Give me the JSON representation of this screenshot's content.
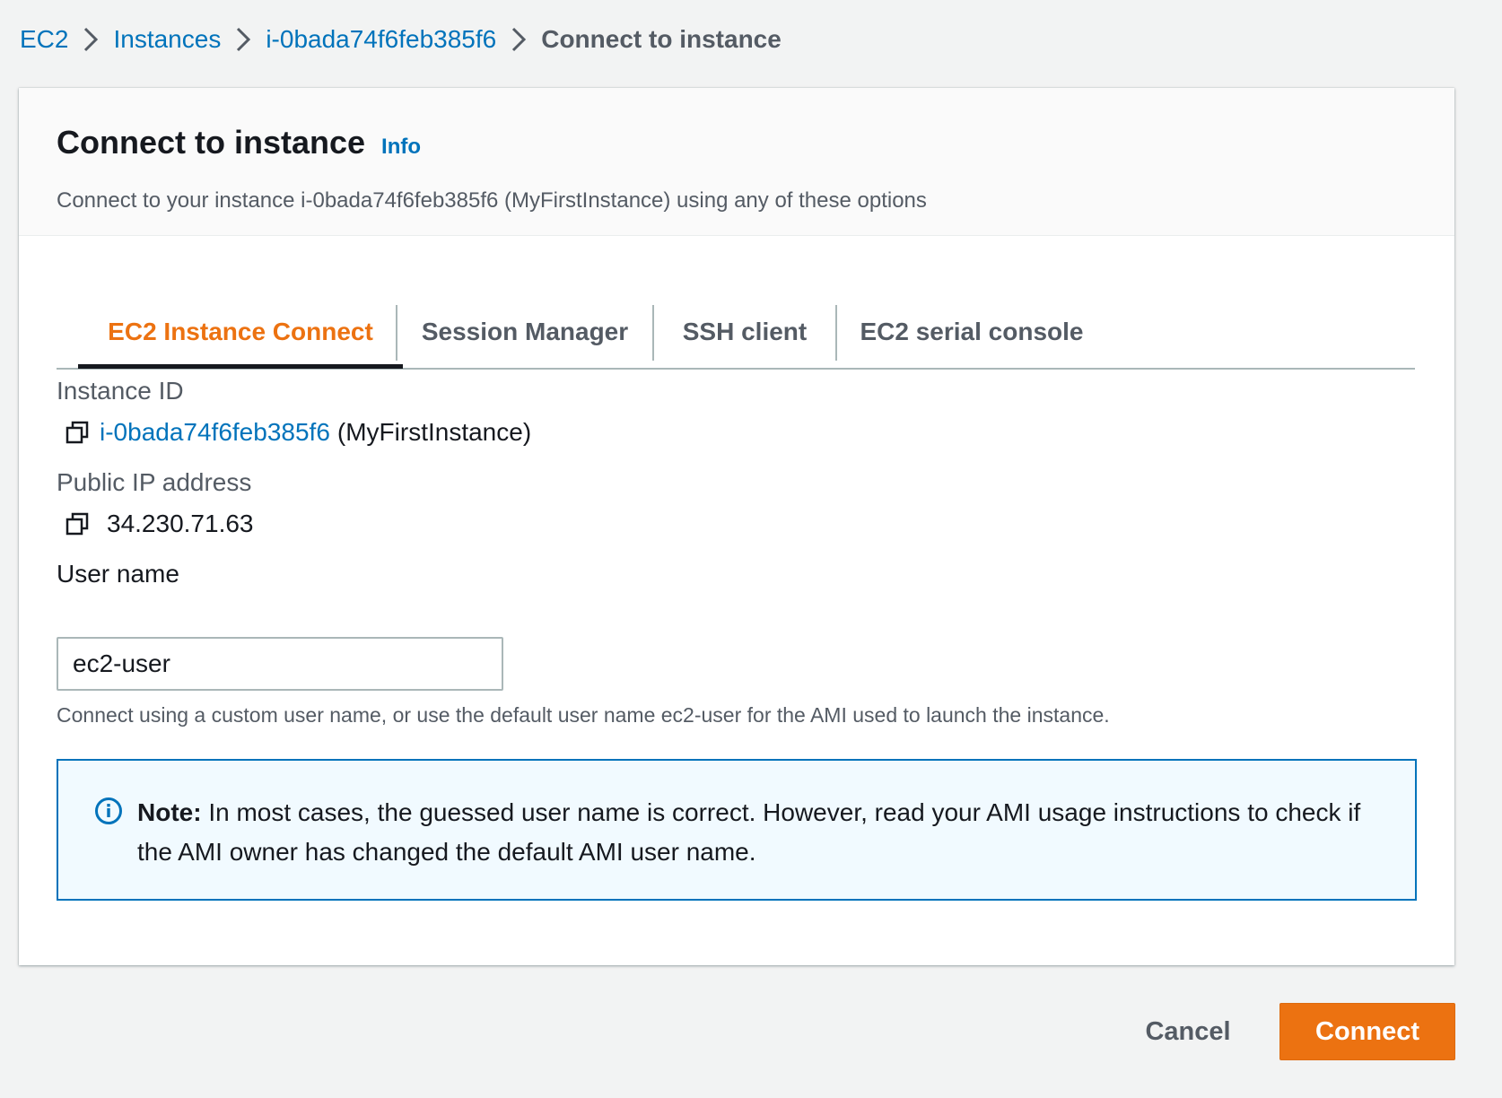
{
  "breadcrumb": {
    "items": [
      {
        "label": "EC2"
      },
      {
        "label": "Instances"
      },
      {
        "label": "i-0bada74f6feb385f6"
      },
      {
        "label": "Connect to instance"
      }
    ]
  },
  "header": {
    "title": "Connect to instance",
    "info_label": "Info",
    "description": "Connect to your instance i-0bada74f6feb385f6 (MyFirstInstance) using any of these options"
  },
  "tabs": [
    {
      "label": "EC2 Instance Connect",
      "active": true
    },
    {
      "label": "Session Manager",
      "active": false
    },
    {
      "label": "SSH client",
      "active": false
    },
    {
      "label": "EC2 serial console",
      "active": false
    }
  ],
  "fields": {
    "instance_id": {
      "label": "Instance ID",
      "value": "i-0bada74f6feb385f6",
      "suffix": "(MyFirstInstance)",
      "icon": "copy-icon"
    },
    "public_ip": {
      "label": "Public IP address",
      "value": "34.230.71.63",
      "icon": "copy-icon"
    },
    "user_name": {
      "label": "User name",
      "value": "ec2-user",
      "help": "Connect using a custom user name, or use the default user name ec2-user for the AMI used to launch the instance."
    }
  },
  "note": {
    "icon": "info-circle-icon",
    "bold_label": "Note:",
    "text": " In most cases, the guessed user name is correct. However, read your AMI usage instructions to check if the AMI owner has changed the default AMI user name."
  },
  "actions": {
    "cancel_label": "Cancel",
    "connect_label": "Connect"
  },
  "colors": {
    "link": "#0073bb",
    "accent": "#ec7211",
    "note_border": "#0073bb",
    "note_background": "#f1faff",
    "page_background": "#f2f3f3"
  }
}
